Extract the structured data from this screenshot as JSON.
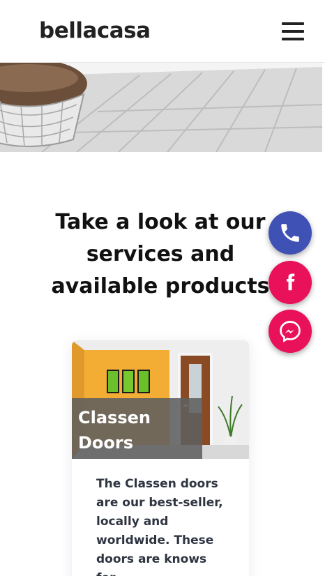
{
  "header": {
    "logo": "bellacasa",
    "menu_icon": "hamburger-menu-icon"
  },
  "hero": {
    "image": "interior-floor-photo"
  },
  "main": {
    "headline_lines": [
      "Take a look at our",
      "services and",
      "available products"
    ]
  },
  "floating_actions": [
    {
      "icon": "phone-icon",
      "color": "#3f51b5"
    },
    {
      "icon": "facebook-icon",
      "color": "#e8115a"
    },
    {
      "icon": "messenger-icon",
      "color": "#e8115a"
    }
  ],
  "card": {
    "title_lines": [
      "Classen",
      "Doors"
    ],
    "description": "The Classen doors are our best-seller, locally and worldwide. These doors are knows for"
  }
}
